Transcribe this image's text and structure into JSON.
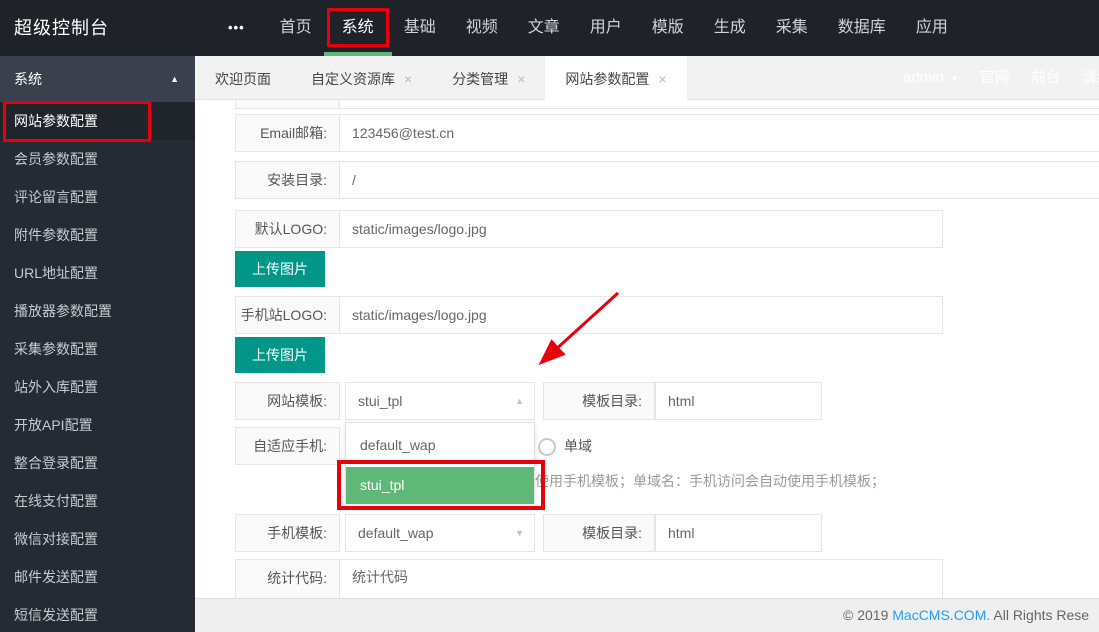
{
  "colors": {
    "accent_green": "#5FB878",
    "button_teal": "#009688",
    "annotation_red": "#E8000D",
    "link_blue": "#1E9FFF",
    "header_dark": "#20222A",
    "sidebar_dark": "#262B33"
  },
  "icons": {
    "more": "•••",
    "caret_up": "▲",
    "caret_down": "▼",
    "close": "×"
  },
  "header": {
    "title": "超级控制台",
    "items": [
      "首页",
      "系统",
      "基础",
      "视频",
      "文章",
      "用户",
      "模版",
      "生成",
      "采集",
      "数据库",
      "应用"
    ]
  },
  "sidebar": {
    "group": "系统",
    "items": [
      "网站参数配置",
      "会员参数配置",
      "评论留言配置",
      "附件参数配置",
      "URL地址配置",
      "播放器参数配置",
      "采集参数配置",
      "站外入库配置",
      "开放API配置",
      "整合登录配置",
      "在线支付配置",
      "微信对接配置",
      "邮件发送配置",
      "短信发送配置"
    ]
  },
  "tabs": [
    {
      "label": "欢迎页面"
    },
    {
      "label": "自定义资源库",
      "close": "×"
    },
    {
      "label": "分类管理",
      "close": "×"
    },
    {
      "label": "网站参数配置",
      "close": "×"
    }
  ],
  "user_menu": {
    "name": "admin",
    "links": [
      "官网",
      "前台",
      "清缓存"
    ]
  },
  "form": {
    "email": {
      "label": "Email邮箱:",
      "value": "123456@test.cn"
    },
    "install": {
      "label": "安装目录:",
      "value": "/"
    },
    "logo": {
      "label": "默认LOGO:",
      "value": "static/images/logo.jpg",
      "button": "上传图片"
    },
    "mlogo": {
      "label": "手机站LOGO:",
      "value": "static/images/logo.jpg",
      "button": "上传图片"
    },
    "site_tpl": {
      "label": "网站模板:",
      "value": "stui_tpl",
      "dir_label": "模板目录:",
      "dir_value": "html"
    },
    "adaptive": {
      "label": "自适应手机:",
      "radio": "单域",
      "help": "使用手机模板；单域名：手机访问会自动使用手机模板；"
    },
    "mobile_tpl": {
      "label": "手机模板:",
      "value": "default_wap",
      "dir_label": "模板目录:",
      "dir_value": "html"
    },
    "stats": {
      "label": "统计代码:",
      "value": "统计代码"
    }
  },
  "dropdown": {
    "options": [
      "default_wap",
      "stui_tpl"
    ],
    "selected": "stui_tpl"
  },
  "footer": {
    "prefix": "© 2019 ",
    "link": "MacCMS.COM.",
    "suffix": " All Rights Rese"
  }
}
